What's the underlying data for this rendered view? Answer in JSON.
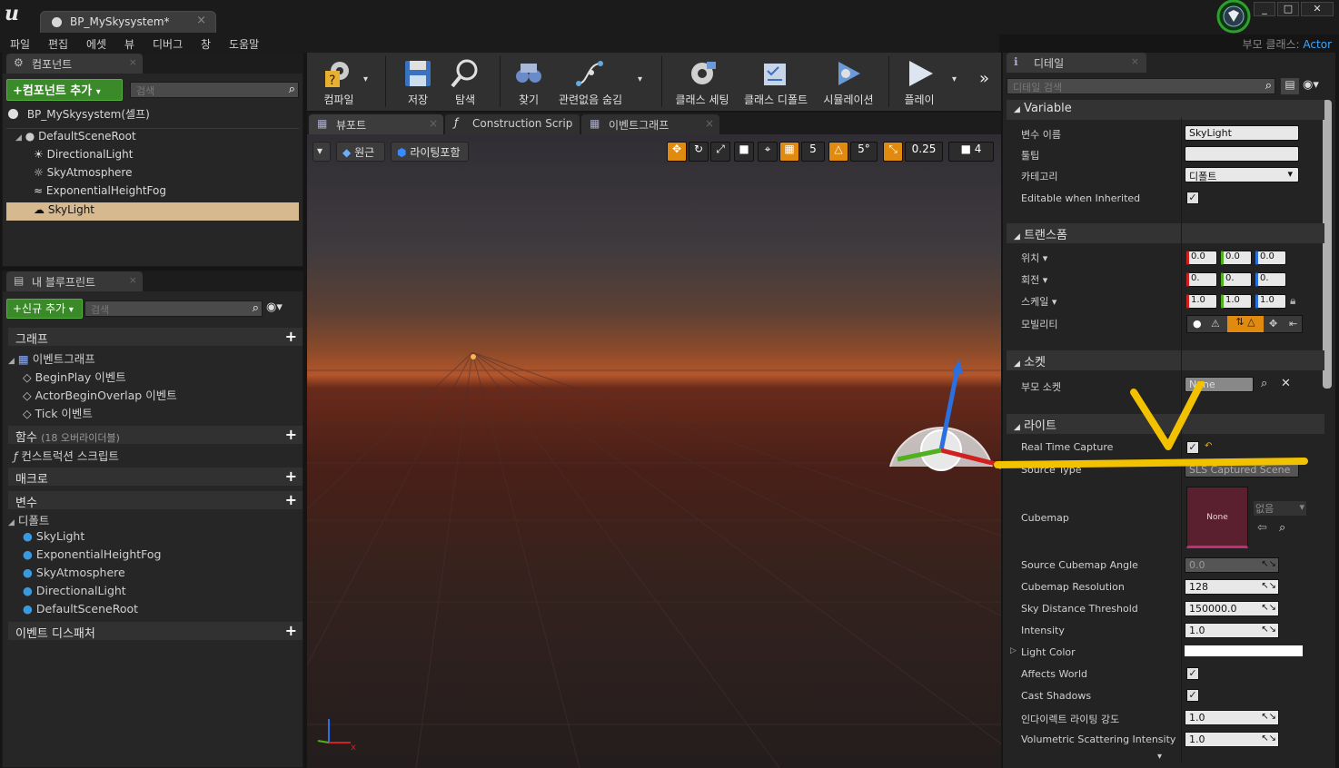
{
  "window": {
    "title": "BP_MySkysystem*",
    "parent_class_label": "부모 클래스:",
    "parent_class_value": "Actor",
    "controls": [
      "_",
      "□",
      "✕"
    ]
  },
  "menu": [
    "파일",
    "편집",
    "에셋",
    "뷰",
    "디버그",
    "창",
    "도움말"
  ],
  "components": {
    "tab": "컴포넌트",
    "add_button": "+컴포넌트 추가",
    "search_placeholder": "검색",
    "self_item": "BP_MySkysystem(셀프)",
    "tree": [
      "DefaultSceneRoot",
      "DirectionalLight",
      "SkyAtmosphere",
      "ExponentialHeightFog",
      "SkyLight"
    ],
    "selected": "SkyLight"
  },
  "my_blueprint": {
    "tab": "내 블루프린트",
    "add_button": "+신규 추가",
    "search_placeholder": "검색",
    "sections": {
      "graph": "그래프",
      "event_graph": "이벤트그래프",
      "events": [
        "BeginPlay 이벤트",
        "ActorBeginOverlap 이벤트",
        "Tick 이벤트"
      ],
      "functions": "함수",
      "functions_sub": "(18 오버라이더블)",
      "construction_script": "컨스트럭션 스크립트",
      "macros": "매크로",
      "variables": "변수",
      "defaults": "디폴트",
      "default_items": [
        "SkyLight",
        "ExponentialHeightFog",
        "SkyAtmosphere",
        "DirectionalLight",
        "DefaultSceneRoot"
      ],
      "dispatchers": "이벤트 디스패처"
    }
  },
  "toolbar": {
    "buttons": [
      "컴파일",
      "저장",
      "탐색",
      "찾기",
      "관련없음 숨김",
      "클래스 세팅",
      "클래스 디폴트",
      "시뮬레이션",
      "플레이"
    ]
  },
  "viewport_tabs": [
    "뷰포트",
    "Construction Scrip",
    "이벤트그래프"
  ],
  "viewport": {
    "perspective": "원근",
    "lit": "라이팅포함",
    "grid_snap": "5",
    "rot_snap": "5°",
    "scale_snap": "0.25",
    "cam_speed": "4"
  },
  "details": {
    "tab": "디테일",
    "search_placeholder": "디테일 검색",
    "variable": {
      "header": "Variable",
      "name_label": "변수 이름",
      "name_value": "SkyLight",
      "tooltip_label": "툴팁",
      "category_label": "카테고리",
      "category_value": "디폴트",
      "editable_label": "Editable when Inherited"
    },
    "transform": {
      "header": "트랜스폼",
      "location_label": "위치",
      "location": [
        "0.0",
        "0.0",
        "0.0"
      ],
      "rotation_label": "회전",
      "rotation": [
        "0.",
        "0.",
        "0."
      ],
      "scale_label": "스케일",
      "scale": [
        "1.0",
        "1.0",
        "1.0"
      ],
      "mobility_label": "모빌리티"
    },
    "sockets": {
      "header": "소켓",
      "parent_socket_label": "부모 소켓",
      "parent_socket_value": "None"
    },
    "light": {
      "header": "라이트",
      "real_time_capture": "Real Time Capture",
      "source_type_label": "Source Type",
      "source_type_value": "SLS Captured Scene",
      "cubemap_label": "Cubemap",
      "cubemap_thumb": "None",
      "cubemap_value": "없음",
      "props": [
        {
          "label": "Source Cubemap Angle",
          "value": "0.0"
        },
        {
          "label": "Cubemap Resolution",
          "value": "128"
        },
        {
          "label": "Sky Distance Threshold",
          "value": "150000.0"
        },
        {
          "label": "Intensity",
          "value": "1.0"
        }
      ],
      "light_color_label": "Light Color",
      "affects_world": "Affects World",
      "cast_shadows": "Cast Shadows",
      "indirect_label": "인다이렉트 라이팅 강도",
      "indirect_value": "1.0",
      "volumetric_label": "Volumetric Scattering Intensity",
      "volumetric_value": "1.0"
    }
  },
  "colors": {
    "accent_green": "#3a8a2a",
    "selection": "#d6b98e",
    "annotation_yellow": "#f2c200",
    "x_red": "#d02020",
    "y_green": "#50b020",
    "z_blue": "#2a70e0"
  }
}
